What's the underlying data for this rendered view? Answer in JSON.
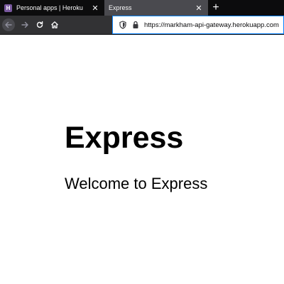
{
  "browser": {
    "tabs": [
      {
        "title": "Personal apps | Heroku",
        "favicon": "heroku-icon",
        "active": false
      },
      {
        "title": "Express",
        "active": true
      }
    ],
    "new_tab_label": "+",
    "close_glyph": "✕",
    "url": "https://markham-api-gateway.herokuapp.com",
    "nav_icons": [
      "back-arrow-icon",
      "forward-arrow-icon",
      "reload-icon",
      "home-icon"
    ]
  },
  "page": {
    "heading": "Express",
    "welcome_text": "Welcome to Express"
  },
  "colors": {
    "tabbar_bg": "#0c0c0d",
    "active_tab_bg": "#4a4a4f",
    "toolbar_bg": "#323234",
    "url_focus_border": "#0a84ff",
    "heroku_purple": "#79589f"
  }
}
